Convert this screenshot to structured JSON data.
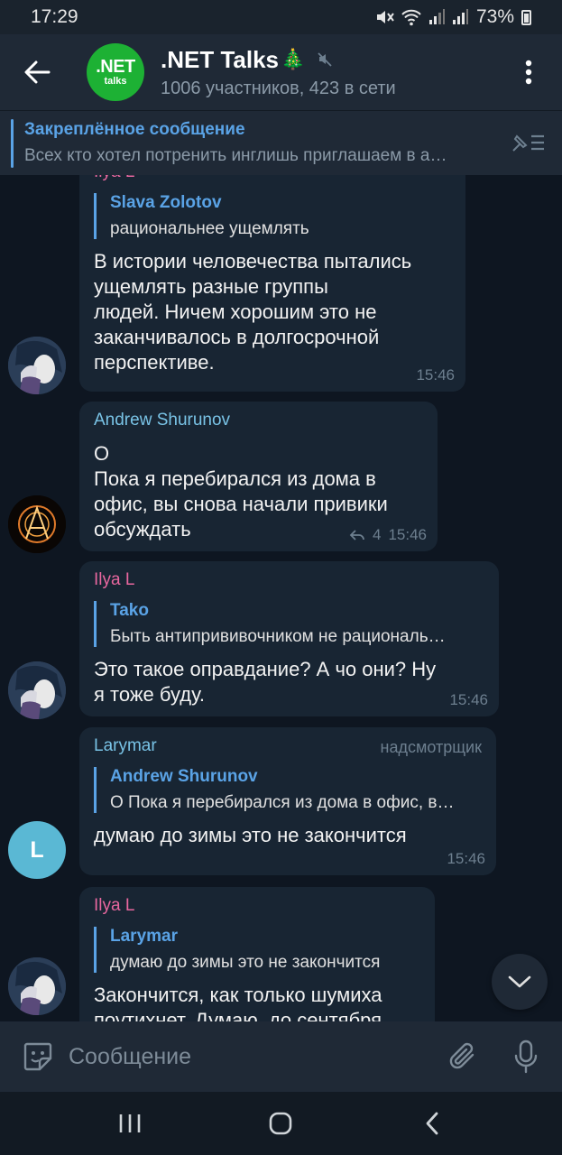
{
  "status_bar": {
    "time": "17:29",
    "battery": "73%",
    "icons": [
      "mute-icon",
      "wifi-icon",
      "signal-icon",
      "signal-icon",
      "battery-icon"
    ]
  },
  "header": {
    "avatar_line1": ".NET",
    "avatar_line2": "talks",
    "title": ".NET Talks",
    "title_emoji": "🎄",
    "subtitle": "1006 участников, 423 в сети",
    "colors": {
      "avatar_bg": "#1db134",
      "header_bg": "#1f2936"
    }
  },
  "pinned": {
    "title": "Закреплённое сообщение",
    "body": "Всех кто хотел потренить инглишь приглашаем в а…"
  },
  "messages": [
    {
      "sender": "Ilya L",
      "quote_name": "Slava Zolotov",
      "quote_text": "рациональнее ущемлять",
      "lines": [
        "В истории человечества пытались",
        "ущемлять разные группы",
        "людей. Ничем хорошим это не",
        "заканчивалось в долгосрочной",
        "перспективе."
      ],
      "time": "15:46"
    },
    {
      "sender": "Andrew Shurunov",
      "lines": [
        "О",
        "Пока я перебирался из дома в",
        "офис, вы снова начали привики",
        "обсуждать"
      ],
      "reply_count": "4",
      "time": "15:46"
    },
    {
      "sender": "Ilya L",
      "quote_name": "Tako",
      "quote_text": "Быть антипрививочником не рациональ…",
      "lines": [
        "Это такое оправдание? А чо они? Ну",
        "я тоже буду."
      ],
      "time": "15:46"
    },
    {
      "sender": "Larymar",
      "role": "надсмотрщик",
      "avatar_letter": "L",
      "quote_name": "Andrew Shurunov",
      "quote_text": "О Пока я перебирался из дома в офис, в…",
      "lines": [
        "думаю до зимы это не закончится"
      ],
      "time": "15:46"
    },
    {
      "sender": "Ilya L",
      "quote_name": "Larymar",
      "quote_text": "думаю до зимы это не закончится",
      "lines": [
        "Закончится, как только шумиха",
        "поутихнет. Думаю, до сентября"
      ]
    }
  ],
  "composer": {
    "placeholder": "Сообщение"
  }
}
